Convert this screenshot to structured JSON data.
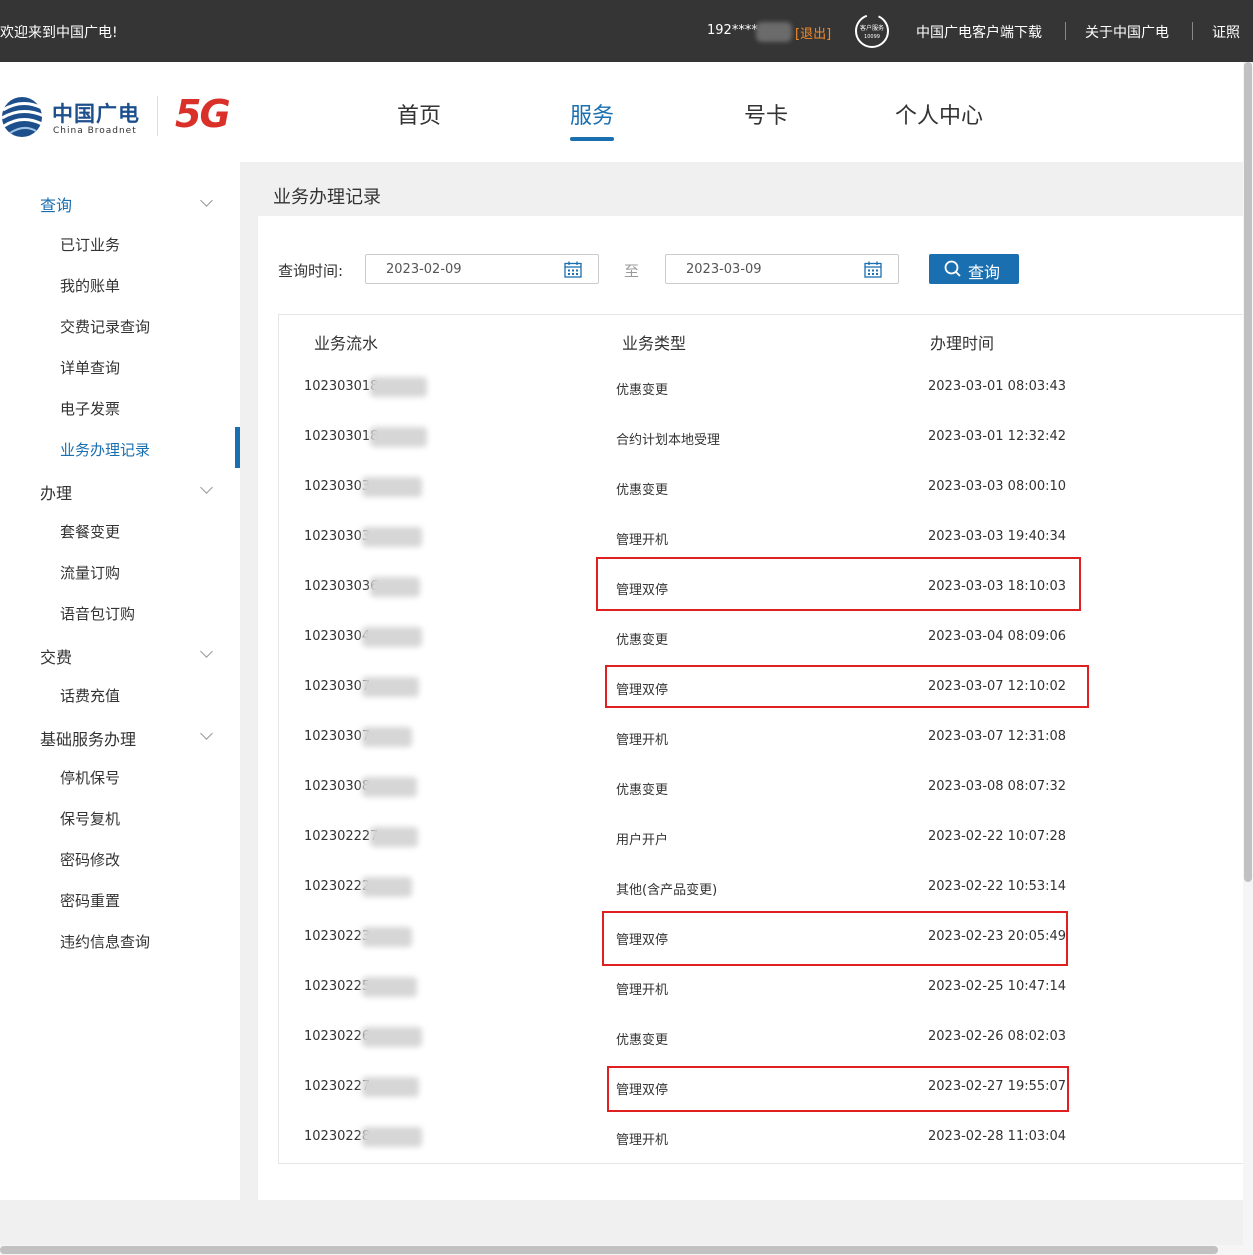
{
  "topbar": {
    "welcome": "欢迎来到中国广电!",
    "phone": "192****",
    "logout": "[退出]",
    "service_icon_label": "客户服务",
    "service_icon_number": "10099",
    "download": "中国广电客户端下载",
    "about": "关于中国广电",
    "cert": "证照"
  },
  "header": {
    "logo_cn": "中国广电",
    "logo_en": "China Broadnet",
    "logo_5g": "5G",
    "nav": [
      "首页",
      "服务",
      "号卡",
      "个人中心"
    ],
    "active_nav": "服务"
  },
  "sidebar": {
    "groups": [
      {
        "label": "查询",
        "items": [
          "已订业务",
          "我的账单",
          "交费记录查询",
          "详单查询",
          "电子发票",
          "业务办理记录"
        ]
      },
      {
        "label": "办理",
        "items": [
          "套餐变更",
          "流量订购",
          "语音包订购"
        ]
      },
      {
        "label": "交费",
        "items": [
          "话费充值"
        ]
      },
      {
        "label": "基础服务办理",
        "items": [
          "停机保号",
          "保号复机",
          "密码修改",
          "密码重置",
          "违约信息查询"
        ]
      }
    ],
    "active_item": "业务办理记录"
  },
  "page": {
    "title": "业务办理记录",
    "query_label": "查询时间:",
    "date_from": "2023-02-09",
    "to_label": "至",
    "date_to": "2023-03-09",
    "query_button": "查询"
  },
  "table": {
    "headers": [
      "业务流水",
      "业务类型",
      "办理时间"
    ],
    "rows": [
      {
        "id": "102303018",
        "type": "优惠变更",
        "time": "2023-03-01 08:03:43",
        "highlight": false
      },
      {
        "id": "102303018",
        "type": "合约计划本地受理",
        "time": "2023-03-01 12:32:42",
        "highlight": false
      },
      {
        "id": "10230303",
        "type": "优惠变更",
        "time": "2023-03-03 08:00:10",
        "highlight": false
      },
      {
        "id": "10230303",
        "type": "管理开机",
        "time": "2023-03-03 19:40:34",
        "highlight": false
      },
      {
        "id": "102303036",
        "type": "管理双停",
        "time": "2023-03-03 18:10:03",
        "highlight": true
      },
      {
        "id": "10230304",
        "type": "优惠变更",
        "time": "2023-03-04 08:09:06",
        "highlight": false
      },
      {
        "id": "10230307",
        "type": "管理双停",
        "time": "2023-03-07 12:10:02",
        "highlight": true
      },
      {
        "id": "10230307",
        "type": "管理开机",
        "time": "2023-03-07 12:31:08",
        "highlight": false
      },
      {
        "id": "10230308",
        "type": "优惠变更",
        "time": "2023-03-08 08:07:32",
        "highlight": false
      },
      {
        "id": "102302227",
        "type": "用户开户",
        "time": "2023-02-22 10:07:28",
        "highlight": false
      },
      {
        "id": "10230222",
        "type": "其他(含产品变更)",
        "time": "2023-02-22 10:53:14",
        "highlight": false
      },
      {
        "id": "10230223",
        "type": "管理双停",
        "time": "2023-02-23 20:05:49",
        "highlight": true
      },
      {
        "id": "10230225",
        "type": "管理开机",
        "time": "2023-02-25 10:47:14",
        "highlight": false
      },
      {
        "id": "10230226",
        "type": "优惠变更",
        "time": "2023-02-26 08:02:03",
        "highlight": false
      },
      {
        "id": "10230227",
        "type": "管理双停",
        "time": "2023-02-27 19:55:07",
        "highlight": true
      },
      {
        "id": "10230228",
        "type": "管理开机",
        "time": "2023-02-28 11:03:04",
        "highlight": false
      }
    ]
  },
  "colors": {
    "accent": "#1a6fb0",
    "topbar_bg": "#353535",
    "logout": "#f08a2c",
    "highlight_box": "#e02020",
    "brand_5g": "#d9302a"
  }
}
